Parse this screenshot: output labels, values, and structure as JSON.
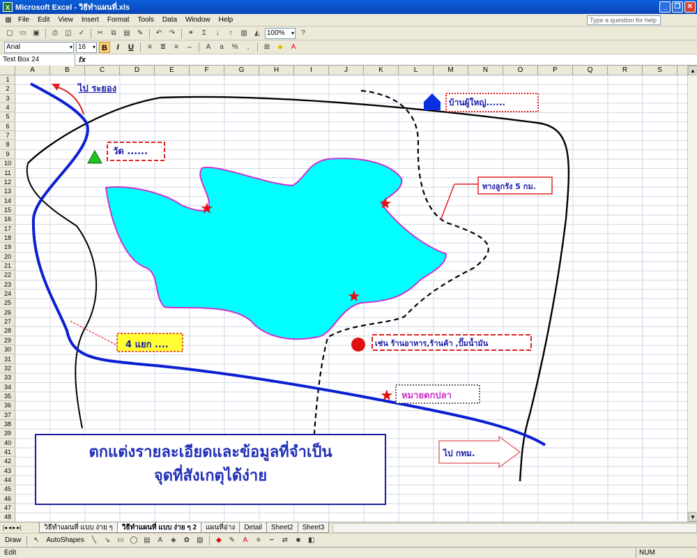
{
  "window": {
    "app_icon": "excel-icon",
    "title": "Microsoft Excel - วิธีทำแผนที่.xls"
  },
  "menu": {
    "items": [
      "File",
      "Edit",
      "View",
      "Insert",
      "Format",
      "Tools",
      "Data",
      "Window",
      "Help"
    ],
    "help_placeholder": "Type a question for help"
  },
  "toolbar": {
    "zoom": "100%",
    "font": "Arial",
    "size": "16"
  },
  "formula_bar": {
    "name_box": "Text Box 24",
    "fx": "fx"
  },
  "columns": [
    "A",
    "B",
    "C",
    "D",
    "E",
    "F",
    "G",
    "H",
    "I",
    "J",
    "K",
    "L",
    "M",
    "N",
    "O",
    "P",
    "Q",
    "R",
    "S"
  ],
  "rows": [
    "1",
    "2",
    "3",
    "4",
    "5",
    "6",
    "7",
    "8",
    "9",
    "10",
    "11",
    "12",
    "13",
    "14",
    "15",
    "16",
    "17",
    "18",
    "19",
    "20",
    "21",
    "22",
    "23",
    "24",
    "25",
    "26",
    "27",
    "28",
    "29",
    "30",
    "31",
    "32",
    "33",
    "34",
    "35",
    "36",
    "37",
    "38",
    "39",
    "40",
    "41",
    "42",
    "43",
    "44",
    "45",
    "46",
    "47",
    "48"
  ],
  "map": {
    "rayong_label": "ไป ระยอง",
    "temple_label": "วัด ......",
    "village_head_label": "บ้านผู้ใหญ่......",
    "laterite_road_label": "ทางลูกรัง 5 กม.",
    "junction_label": "4 แยก ....",
    "shops_label": "เช่น ร้านอาหาร,ร้านค้า ,ปั๊มน้ำมัน",
    "fishing_label": "หมายตกปลา",
    "bangkok_label": "ไป กทม.",
    "main_text_line1": "ตกแต่งรายละเอียดและข้อมูลที่จำเป็น",
    "main_text_line2": "จุดที่สังเกตุได้ง่าย",
    "colors": {
      "lake_fill": "#00ffff",
      "lake_border": "#cc33cc",
      "highway": "#0a1fd0",
      "dashed_road": "#000000",
      "label_blue": "#1a1aa8",
      "box_red": "#e02020",
      "star": "#e01010",
      "temple_triangle": "#22c022",
      "house": "#0b2fe0",
      "fishing_text": "#cc33cc",
      "junction_bg": "#ffff33"
    }
  },
  "sheets": {
    "tabs": [
      "วิธีทำแผนที่ แบบ ง่าย ๆ",
      "วิธีทำแผนที่ แบบ ง่าย ๆ 2",
      "แผนที่อ่าง",
      "Detail",
      "Sheet2",
      "Sheet3"
    ],
    "active_index": 1
  },
  "drawbar": {
    "draw_label": "Draw",
    "autoshapes_label": "AutoShapes"
  },
  "status": {
    "left": "Edit",
    "num": "NUM"
  }
}
